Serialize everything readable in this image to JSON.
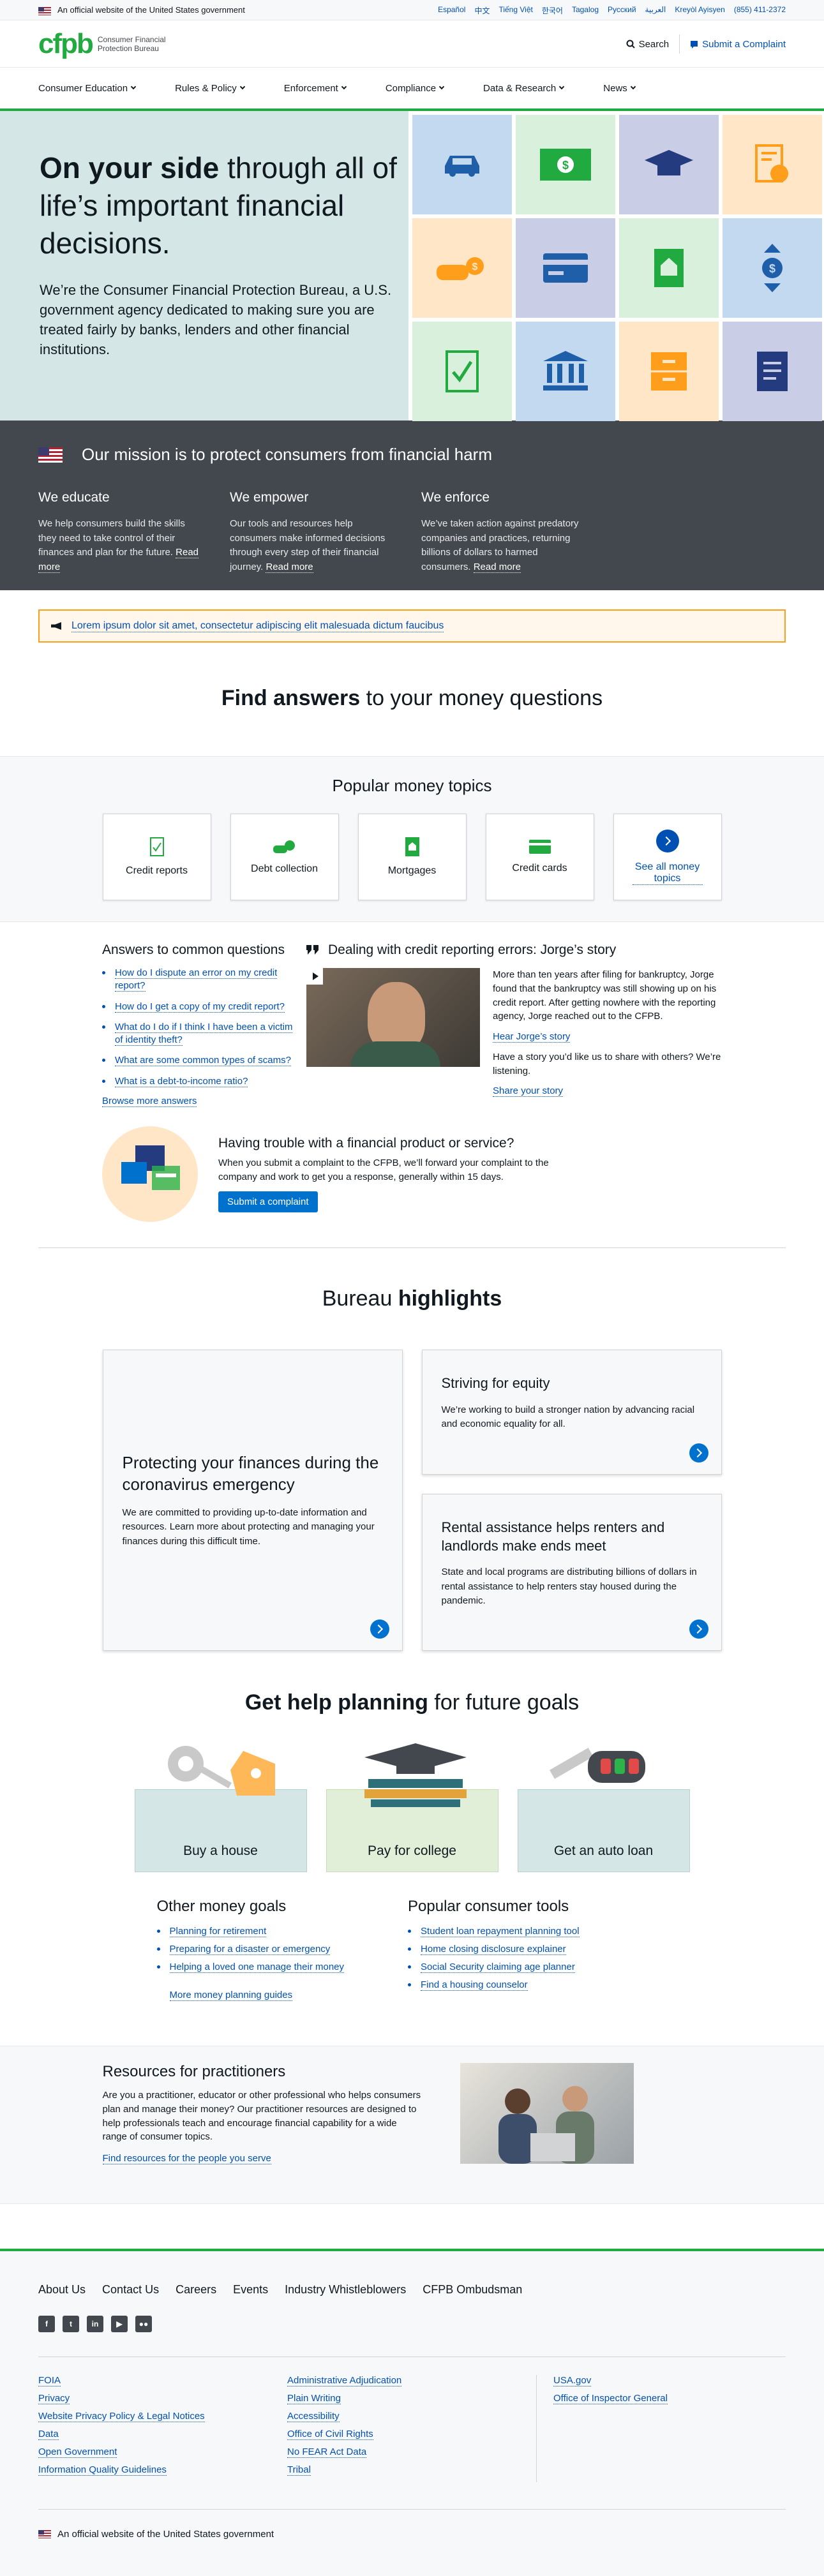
{
  "gov_banner": {
    "official_text": "An official website of the United States government",
    "languages": [
      "Español",
      "中文",
      "Tiếng Việt",
      "한국어",
      "Tagalog",
      "Русский",
      "العربية",
      "Kreyòl Ayisyen"
    ],
    "phone": "(855) 411-2372"
  },
  "header": {
    "logo": "cfpb",
    "logo_text": "Consumer Financial Protection Bureau",
    "search": "Search",
    "submit_complaint": "Submit a Complaint"
  },
  "nav": [
    "Consumer Education",
    "Rules & Policy",
    "Enforcement",
    "Compliance",
    "Data & Research",
    "News"
  ],
  "hero": {
    "title_bold": "On your side",
    "title_rest": " through all of life’s important financial decisions.",
    "body": "We’re the Consumer Financial Protection Bureau, a U.S. government agency dedicated to making sure you are treated fairly by banks, lenders and other financial institutions."
  },
  "mission": {
    "title": "Our mission is to protect consumers from financial harm",
    "cols": [
      {
        "title": "We educate",
        "body": "We help consumers build the skills they need to take control of their finances and plan for the future.",
        "link": "Read more"
      },
      {
        "title": "We empower",
        "body": "Our tools and resources help consumers make informed decisions through every step of their financial journey.",
        "link": "Read more"
      },
      {
        "title": "We enforce",
        "body": "We’ve taken action against predatory companies and practices, returning billions of dollars to harmed consumers.",
        "link": "Read more"
      }
    ]
  },
  "alert": "Lorem ipsum dolor sit amet, consectetur adipiscing elit malesuada dictum faucibus",
  "find": {
    "bold": "Find answers",
    "rest": " to your money questions"
  },
  "topics": {
    "title": "Popular money topics",
    "items": [
      "Credit reports",
      "Debt collection",
      "Mortgages",
      "Credit cards"
    ],
    "see_all": "See all money topics"
  },
  "answers": {
    "title": "Answers to common questions",
    "items": [
      "How do I dispute an error on my credit report?",
      "How do I get a copy of my credit report?",
      "What do I do if I think I have been a victim of identity theft?",
      "What are some common types of scams?",
      "What is a debt-to-income ratio?"
    ],
    "browse": "Browse more answers"
  },
  "story": {
    "title": "Dealing with credit reporting errors: Jorge’s story",
    "body": "More than ten years after filing for bankruptcy, Jorge found that the bankruptcy was still showing up on his credit report. After getting nowhere with the reporting agency, Jorge reached out to the CFPB.",
    "link1": "Hear Jorge’s story",
    "ask": "Have a story you’d like us to share with others? We’re listening.",
    "link2": "Share your story"
  },
  "complaint": {
    "title": "Having trouble with a financial product or service?",
    "body": "When you submit a complaint to the CFPB, we’ll forward your complaint to the company and work to get you a response, generally within 15 days.",
    "button": "Submit a complaint"
  },
  "highlights": {
    "title_rest": "Bureau ",
    "title_bold": "highlights",
    "big": {
      "title": "Protecting your finances during the coronavirus emergency",
      "body": "We are committed to providing up-to-date information and resources. Learn more about protecting and managing your finances during this difficult time."
    },
    "equity": {
      "title": "Striving for equity",
      "body": "We’re working to build a stronger nation by advancing racial and economic equality for all."
    },
    "rental": {
      "title": "Rental assistance helps renters and landlords make ends meet",
      "body": "State and local programs are distributing billions of dollars in rental assistance to help renters stay housed during the pandemic."
    }
  },
  "plan": {
    "bold": "Get help planning",
    "rest": " for future goals",
    "cards": [
      "Buy a house",
      "Pay for college",
      "Get an auto loan"
    ]
  },
  "goals": {
    "left_title": "Other money goals",
    "left_items": [
      "Planning for retirement",
      "Preparing for a disaster or emergency",
      "Helping a loved one manage their money"
    ],
    "left_more": "More money planning guides",
    "right_title": "Popular consumer tools",
    "right_items": [
      "Student loan repayment planning tool",
      "Home closing disclosure explainer",
      "Social Security claiming age planner",
      "Find a housing counselor"
    ]
  },
  "practitioners": {
    "title": "Resources for practitioners",
    "body": "Are you a practitioner, educator or other professional who helps consumers plan and manage their money? Our practitioner resources are designed to help professionals teach and encourage financial capability for a wide range of consumer topics.",
    "link": "Find resources for the people you serve"
  },
  "footer": {
    "nav": [
      "About Us",
      "Contact Us",
      "Careers",
      "Events",
      "Industry Whistleblowers",
      "CFPB Ombudsman"
    ],
    "col1": [
      "FOIA",
      "Privacy",
      "Website Privacy Policy & Legal Notices",
      "Data",
      "Open Government",
      "Information Quality Guidelines"
    ],
    "col2": [
      "Administrative Adjudication",
      "Plain Writing",
      "Accessibility",
      "Office of Civil Rights",
      "No FEAR Act Data",
      "Tribal"
    ],
    "col3": [
      "USA.gov",
      "Office of Inspector General"
    ],
    "official": "An official website of the United States government"
  },
  "colors": {
    "brand_green": "#20aa3f",
    "link_blue": "#0050b4",
    "button_blue": "#0072ce",
    "dark_gray": "#43484e",
    "hero_teal": "#d4e7e6"
  }
}
